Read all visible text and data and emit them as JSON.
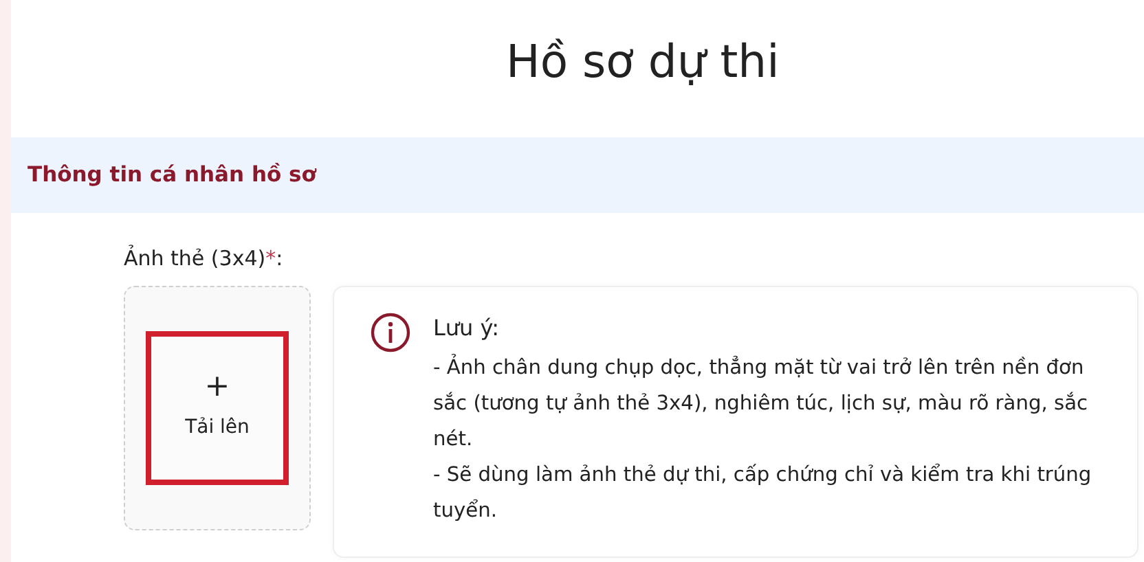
{
  "page_title": "Hồ sơ dự thi",
  "section": {
    "title": "Thông tin cá nhân hồ sơ"
  },
  "photo_field": {
    "label": "Ảnh thẻ (3x4)",
    "required_mark": "*",
    "label_suffix": ":",
    "upload": {
      "icon": "+",
      "label": "Tải lên",
      "highlighted": true
    }
  },
  "note": {
    "title": "Lưu ý:",
    "lines": [
      "- Ảnh chân dung chụp dọc, thẳng mặt từ vai trở lên trên nền đơn sắc (tương tự ảnh thẻ 3x4), nghiêm túc, lịch sự, màu rõ ràng, sắc nét.",
      "- Sẽ dùng làm ảnh thẻ dự thi, cấp chứng chỉ và kiểm tra khi trúng tuyển."
    ]
  }
}
